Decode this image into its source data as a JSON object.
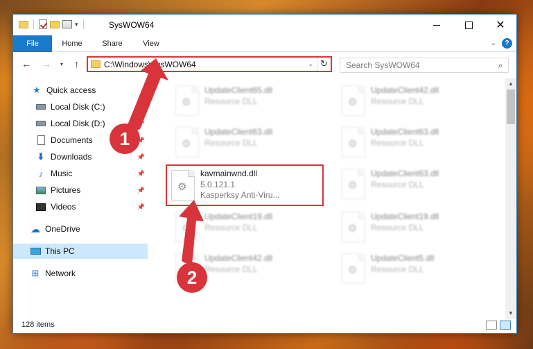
{
  "window": {
    "title": "SysWOW64"
  },
  "ribbon": {
    "tabs": [
      "File",
      "Home",
      "Share",
      "View"
    ]
  },
  "navigation": {
    "address": "C:\\Windows\\SysWOW64",
    "search_placeholder": "Search SysWOW64"
  },
  "sidebar": {
    "items": [
      {
        "label": "Quick access",
        "icon": "star-icon"
      },
      {
        "label": "Local Disk (C:)",
        "icon": "drive-icon"
      },
      {
        "label": "Local Disk (D:)",
        "icon": "drive-icon"
      },
      {
        "label": "Documents",
        "icon": "documents-icon"
      },
      {
        "label": "Downloads",
        "icon": "downloads-icon"
      },
      {
        "label": "Music",
        "icon": "music-icon"
      },
      {
        "label": "Pictures",
        "icon": "pictures-icon"
      },
      {
        "label": "Videos",
        "icon": "videos-icon"
      },
      {
        "label": "OneDrive",
        "icon": "cloud-icon"
      },
      {
        "label": "This PC",
        "icon": "computer-icon",
        "selected": true
      },
      {
        "label": "Network",
        "icon": "network-icon"
      }
    ]
  },
  "files": {
    "left": [
      {
        "name": "UpdateClient65.dll",
        "type": "Resource DLL"
      },
      {
        "name": "UpdateClient63.dll",
        "type": "Resource DLL"
      },
      {
        "name": "kavmainwnd.dll",
        "version": "5.0.121.1",
        "company": "Kasperksy Anti-Viru..."
      },
      {
        "name": "UpdateClient19.dll",
        "type": "Resource DLL"
      },
      {
        "name": "UpdateClient42.dll",
        "type": "Resource DLL"
      }
    ],
    "right": [
      {
        "name": "UpdateClient42.dll",
        "type": "Resource DLL"
      },
      {
        "name": "UpdateClient63.dll",
        "type": "Resource DLL"
      },
      {
        "name": "UpdateClient63.dll",
        "type": "Resource DLL"
      },
      {
        "name": "UpdateClient19.dll",
        "type": "Resource DLL"
      },
      {
        "name": "UpdateClient5.dll",
        "type": "Resource DLL"
      }
    ]
  },
  "status": {
    "item_count": "128 items"
  },
  "callouts": [
    "1",
    "2"
  ],
  "colors": {
    "accent": "#1979ca",
    "highlight": "#d9343b",
    "selection": "#cce8ff"
  }
}
